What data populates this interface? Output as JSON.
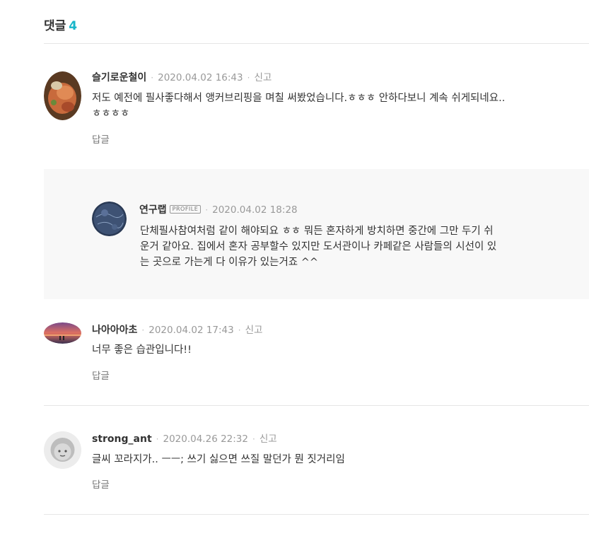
{
  "header": {
    "title": "댓글",
    "count": "4"
  },
  "comments": [
    {
      "author": "슬기로운철이",
      "date": "2020.04.02 16:43",
      "report": "신고",
      "text_line1": "저도 예전에 필사좋다해서 앵커브리핑을 며칠 써봤었습니다.ㅎㅎㅎ 안하다보니 계속 쉬게되네요..",
      "text_line2": "ㅎㅎㅎㅎ",
      "reply": "답글"
    },
    {
      "author": "연구랩",
      "badge": "PROFILE",
      "date": "2020.04.02 18:28",
      "text_line1": "단체필사참여처럼 같이 해야되요 ㅎㅎ 뭐든 혼자하게 방치하면 중간에 그만 두기 쉬",
      "text_line2": "운거 같아요. 집에서 혼자 공부할수 있지만 도서관이나 카페같은 사람들의 시선이 있",
      "text_line3": "는 곳으로 가는게 다 이유가 있는거죠 ^^"
    },
    {
      "author": "나아아아초",
      "date": "2020.04.02 17:43",
      "report": "신고",
      "text_line1": "너무 좋은 습관입니다!!",
      "reply": "답글"
    },
    {
      "author": "strong_ant",
      "date": "2020.04.26 22:32",
      "report": "신고",
      "text_line1": "글씨 꼬라지가.. ㅡㅡ; 쓰기 싫으면 쓰질 말던가 뭔 짓거리임",
      "reply": "답글"
    }
  ]
}
